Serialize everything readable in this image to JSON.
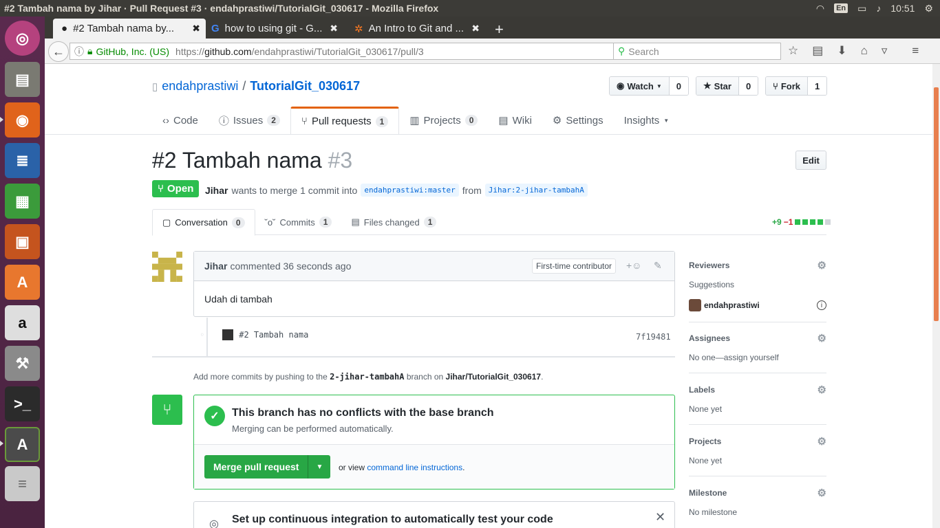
{
  "window": {
    "title": "#2 Tambah nama by Jihar · Pull Request #3 · endahprastiwi/TutorialGit_030617 - Mozilla Firefox"
  },
  "tray": {
    "lang": "En",
    "time": "10:51"
  },
  "tabs": [
    {
      "label": "#2 Tambah nama by..."
    },
    {
      "label": "how to using git - G..."
    },
    {
      "label": "An Intro to Git and ..."
    }
  ],
  "nav": {
    "site": "GitHub, Inc. (US)",
    "url_prefix": "https://",
    "url_domain": "github.com",
    "url_path": "/endahprastiwi/TutorialGit_030617/pull/3",
    "search_placeholder": "Search"
  },
  "repo": {
    "owner": "endahprastiwi",
    "sep": "/",
    "name": "TutorialGit_030617",
    "watch": "Watch",
    "watch_count": "0",
    "star": "Star",
    "star_count": "0",
    "fork": "Fork",
    "fork_count": "1"
  },
  "reponav": {
    "code": "Code",
    "issues": "Issues",
    "issues_count": "2",
    "pulls": "Pull requests",
    "pulls_count": "1",
    "projects": "Projects",
    "projects_count": "0",
    "wiki": "Wiki",
    "settings": "Settings",
    "insights": "Insights"
  },
  "pr": {
    "title": "#2 Tambah nama",
    "number": "#3",
    "edit": "Edit",
    "state": "Open",
    "author": "Jihar",
    "meta_text": "wants to merge 1 commit into",
    "base": "endahprastiwi:master",
    "from": "from",
    "head": "Jihar:2-jihar-tambahA"
  },
  "prtabs": {
    "conversation": "Conversation",
    "conversation_count": "0",
    "commits": "Commits",
    "commits_count": "1",
    "files": "Files changed",
    "files_count": "1"
  },
  "diffstat": {
    "add": "+9",
    "del": "−1"
  },
  "comment": {
    "author": "Jihar",
    "action": "commented 36 seconds ago",
    "badge": "First-time contributor",
    "body": "Udah di tambah"
  },
  "commit": {
    "message": "#2 Tambah nama",
    "sha": "7f19481"
  },
  "hint": {
    "pre": "Add more commits by pushing to the",
    "branch": "2-jihar-tambahA",
    "mid": "branch on",
    "repo": "Jihar/TutorialGit_030617",
    "end": "."
  },
  "merge": {
    "title": "This branch has no conflicts with the base branch",
    "sub": "Merging can be performed automatically.",
    "button": "Merge pull request",
    "or_view": "or view",
    "link": "command line instructions",
    "dot": "."
  },
  "ci": {
    "title": "Set up continuous integration to automatically test your code"
  },
  "sidebar": {
    "reviewers": "Reviewers",
    "suggestions": "Suggestions",
    "reviewer": "endahprastiwi",
    "assignees": "Assignees",
    "assignees_val": "No one—assign yourself",
    "labels": "Labels",
    "labels_val": "None yet",
    "projects": "Projects",
    "projects_val": "None yet",
    "milestone": "Milestone",
    "milestone_val": "No milestone"
  }
}
